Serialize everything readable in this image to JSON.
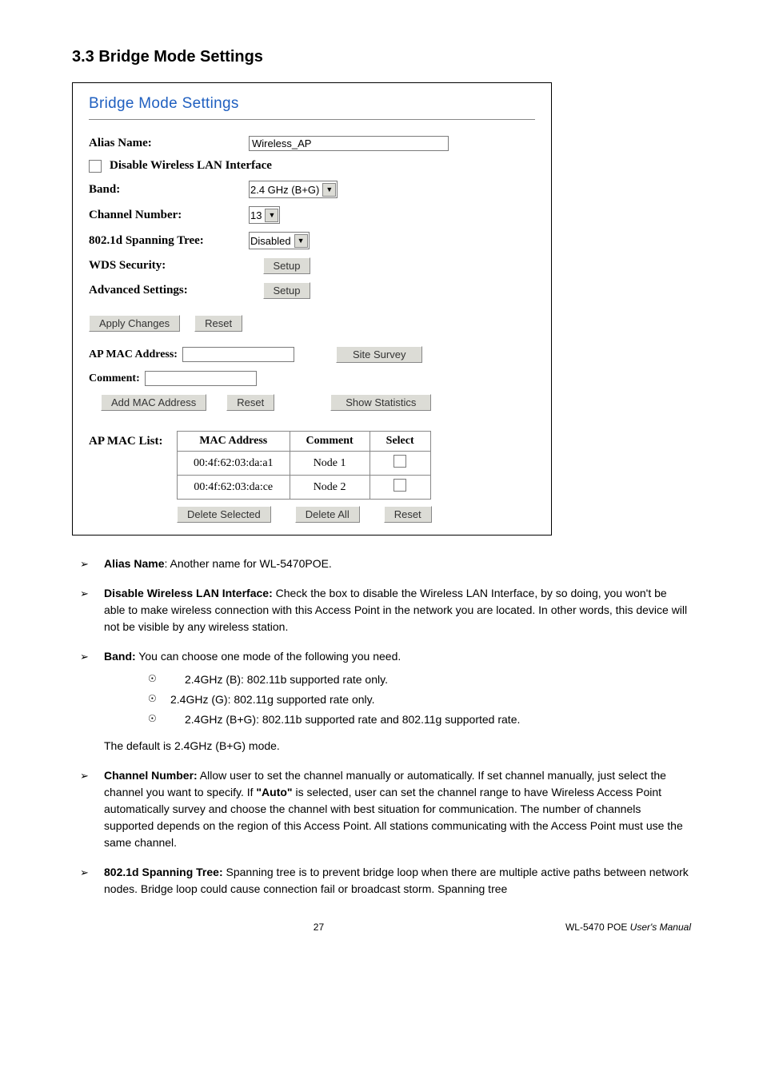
{
  "section_title": "3.3 Bridge Mode Settings",
  "panel": {
    "title": "Bridge Mode Settings",
    "alias_label": "Alias Name:",
    "alias_value": "Wireless_AP",
    "disable_wlan_label": "Disable Wireless LAN Interface",
    "band_label": "Band:",
    "band_value": "2.4 GHz (B+G)",
    "channel_label": "Channel Number:",
    "channel_value": "13",
    "spanning_label": "802.1d Spanning Tree:",
    "spanning_value": "Disabled",
    "wds_label": "WDS Security:",
    "wds_btn": "Setup",
    "advanced_label": "Advanced Settings:",
    "advanced_btn": "Setup",
    "apply_btn": "Apply Changes",
    "reset_btn": "Reset",
    "ap_mac_label": "AP MAC Address:",
    "site_survey_btn": "Site Survey",
    "comment_label": "Comment:",
    "add_mac_btn": "Add MAC Address",
    "reset2_btn": "Reset",
    "show_stats_btn": "Show Statistics",
    "ap_mac_list_label": "AP MAC List:",
    "table": {
      "headers": [
        "MAC Address",
        "Comment",
        "Select"
      ],
      "rows": [
        {
          "mac": "00:4f:62:03:da:a1",
          "comment": "Node 1"
        },
        {
          "mac": "00:4f:62:03:da:ce",
          "comment": "Node 2"
        }
      ]
    },
    "delete_selected_btn": "Delete Selected",
    "delete_all_btn": "Delete All",
    "reset3_btn": "Reset"
  },
  "bullets": {
    "alias": {
      "bold": "Alias Name",
      "text": ": Another name for WL-5470POE."
    },
    "disable": {
      "bold": "Disable Wireless LAN Interface:",
      "text": " Check the box to disable the Wireless LAN Interface, by so doing, you won't be able to make wireless connection with this Access Point in the network you are located. In other words, this device will not be visible by any wireless station."
    },
    "band": {
      "bold": "Band:",
      "text": " You can choose one mode of the following you need."
    },
    "band_sub": [
      "2.4GHz (B): 802.11b supported rate only.",
      "2.4GHz (G): 802.11g supported rate only.",
      "2.4GHz (B+G): 802.11b supported rate and 802.11g supported rate."
    ],
    "band_default": "The default is 2.4GHz (B+G) mode.",
    "channel": {
      "bold": "Channel Number:",
      "text_before_auto": " Allow user to set the channel manually or automatically. If set channel manually, just select the channel you want to specify. If ",
      "auto": "\"Auto\"",
      "text_after_auto": " is selected, user can set the channel range to have Wireless Access Point automatically survey and choose the channel with best situation for communication. The number of channels supported depends on the region of this Access Point. All stations communicating with the Access Point must use the same channel."
    },
    "spanning": {
      "bold": "802.1d Spanning Tree:",
      "text": " Spanning tree is to prevent bridge loop when there are multiple active paths between network nodes. Bridge loop could cause connection fail or broadcast storm. Spanning tree"
    }
  },
  "footer": {
    "page": "27",
    "product": "WL-5470 POE",
    "suffix": "User's Manual"
  }
}
